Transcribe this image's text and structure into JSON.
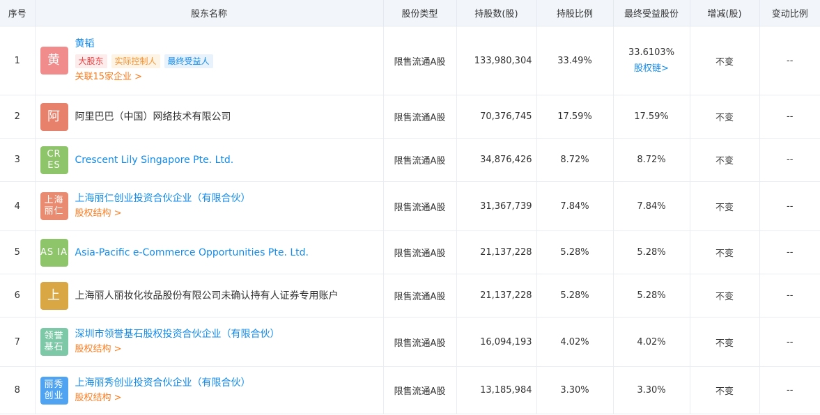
{
  "headers": {
    "idx": "序号",
    "name": "股东名称",
    "type": "股份类型",
    "shares": "持股数(股)",
    "ratio": "持股比例",
    "final": "最终受益股份",
    "change": "增减(股)",
    "change_ratio": "变动比例"
  },
  "rows": [
    {
      "idx": "1",
      "avatar": "黄",
      "avatar_color": "#f08c8c",
      "name": "黄韬",
      "name_link": true,
      "tags": [
        "大股东",
        "实际控制人",
        "最终受益人"
      ],
      "sublink": "关联15家企业 >",
      "type": "限售流通A股",
      "shares": "133,980,304",
      "ratio": "33.49%",
      "final": "33.6103%",
      "final_link": "股权链>",
      "change": "不变",
      "change_ratio": "--"
    },
    {
      "idx": "2",
      "avatar": "阿",
      "avatar_color": "#e8816b",
      "name": "阿里巴巴（中国）网络技术有限公司",
      "name_link": false,
      "type": "限售流通A股",
      "shares": "70,376,745",
      "ratio": "17.59%",
      "final": "17.59%",
      "change": "不变",
      "change_ratio": "--"
    },
    {
      "idx": "3",
      "avatar": "CR ES",
      "avatar_color": "#8ec46a",
      "name": "Crescent Lily Singapore Pte. Ltd.",
      "name_link": true,
      "type": "限售流通A股",
      "shares": "34,876,426",
      "ratio": "8.72%",
      "final": "8.72%",
      "change": "不变",
      "change_ratio": "--"
    },
    {
      "idx": "4",
      "avatar": "上海 丽仁",
      "avatar_color": "#e98b70",
      "name": "上海丽仁创业投资合伙企业（有限合伙）",
      "name_link": true,
      "sublink": "股权结构 >",
      "type": "限售流通A股",
      "shares": "31,367,739",
      "ratio": "7.84%",
      "final": "7.84%",
      "change": "不变",
      "change_ratio": "--"
    },
    {
      "idx": "5",
      "avatar": "AS IA",
      "avatar_color": "#8ec46a",
      "name": "Asia-Pacific e-Commerce Opportunities Pte. Ltd.",
      "name_link": true,
      "type": "限售流通A股",
      "shares": "21,137,228",
      "ratio": "5.28%",
      "final": "5.28%",
      "change": "不变",
      "change_ratio": "--"
    },
    {
      "idx": "6",
      "avatar": "上",
      "avatar_color": "#d9a845",
      "name": "上海丽人丽妆化妆品股份有限公司未确认持有人证券专用账户",
      "name_link": false,
      "type": "限售流通A股",
      "shares": "21,137,228",
      "ratio": "5.28%",
      "final": "5.28%",
      "change": "不变",
      "change_ratio": "--"
    },
    {
      "idx": "7",
      "avatar": "领誉 基石",
      "avatar_color": "#7dc8a6",
      "name": "深圳市领誉基石股权投资合伙企业（有限合伙）",
      "name_link": true,
      "sublink": "股权结构 >",
      "type": "限售流通A股",
      "shares": "16,094,193",
      "ratio": "4.02%",
      "final": "4.02%",
      "change": "不变",
      "change_ratio": "--"
    },
    {
      "idx": "8",
      "avatar": "丽秀 创业",
      "avatar_color": "#4fa3f0",
      "name": "上海丽秀创业投资合伙企业（有限合伙）",
      "name_link": true,
      "sublink": "股权结构 >",
      "type": "限售流通A股",
      "shares": "13,185,984",
      "ratio": "3.30%",
      "final": "3.30%",
      "change": "不变",
      "change_ratio": "--"
    }
  ]
}
